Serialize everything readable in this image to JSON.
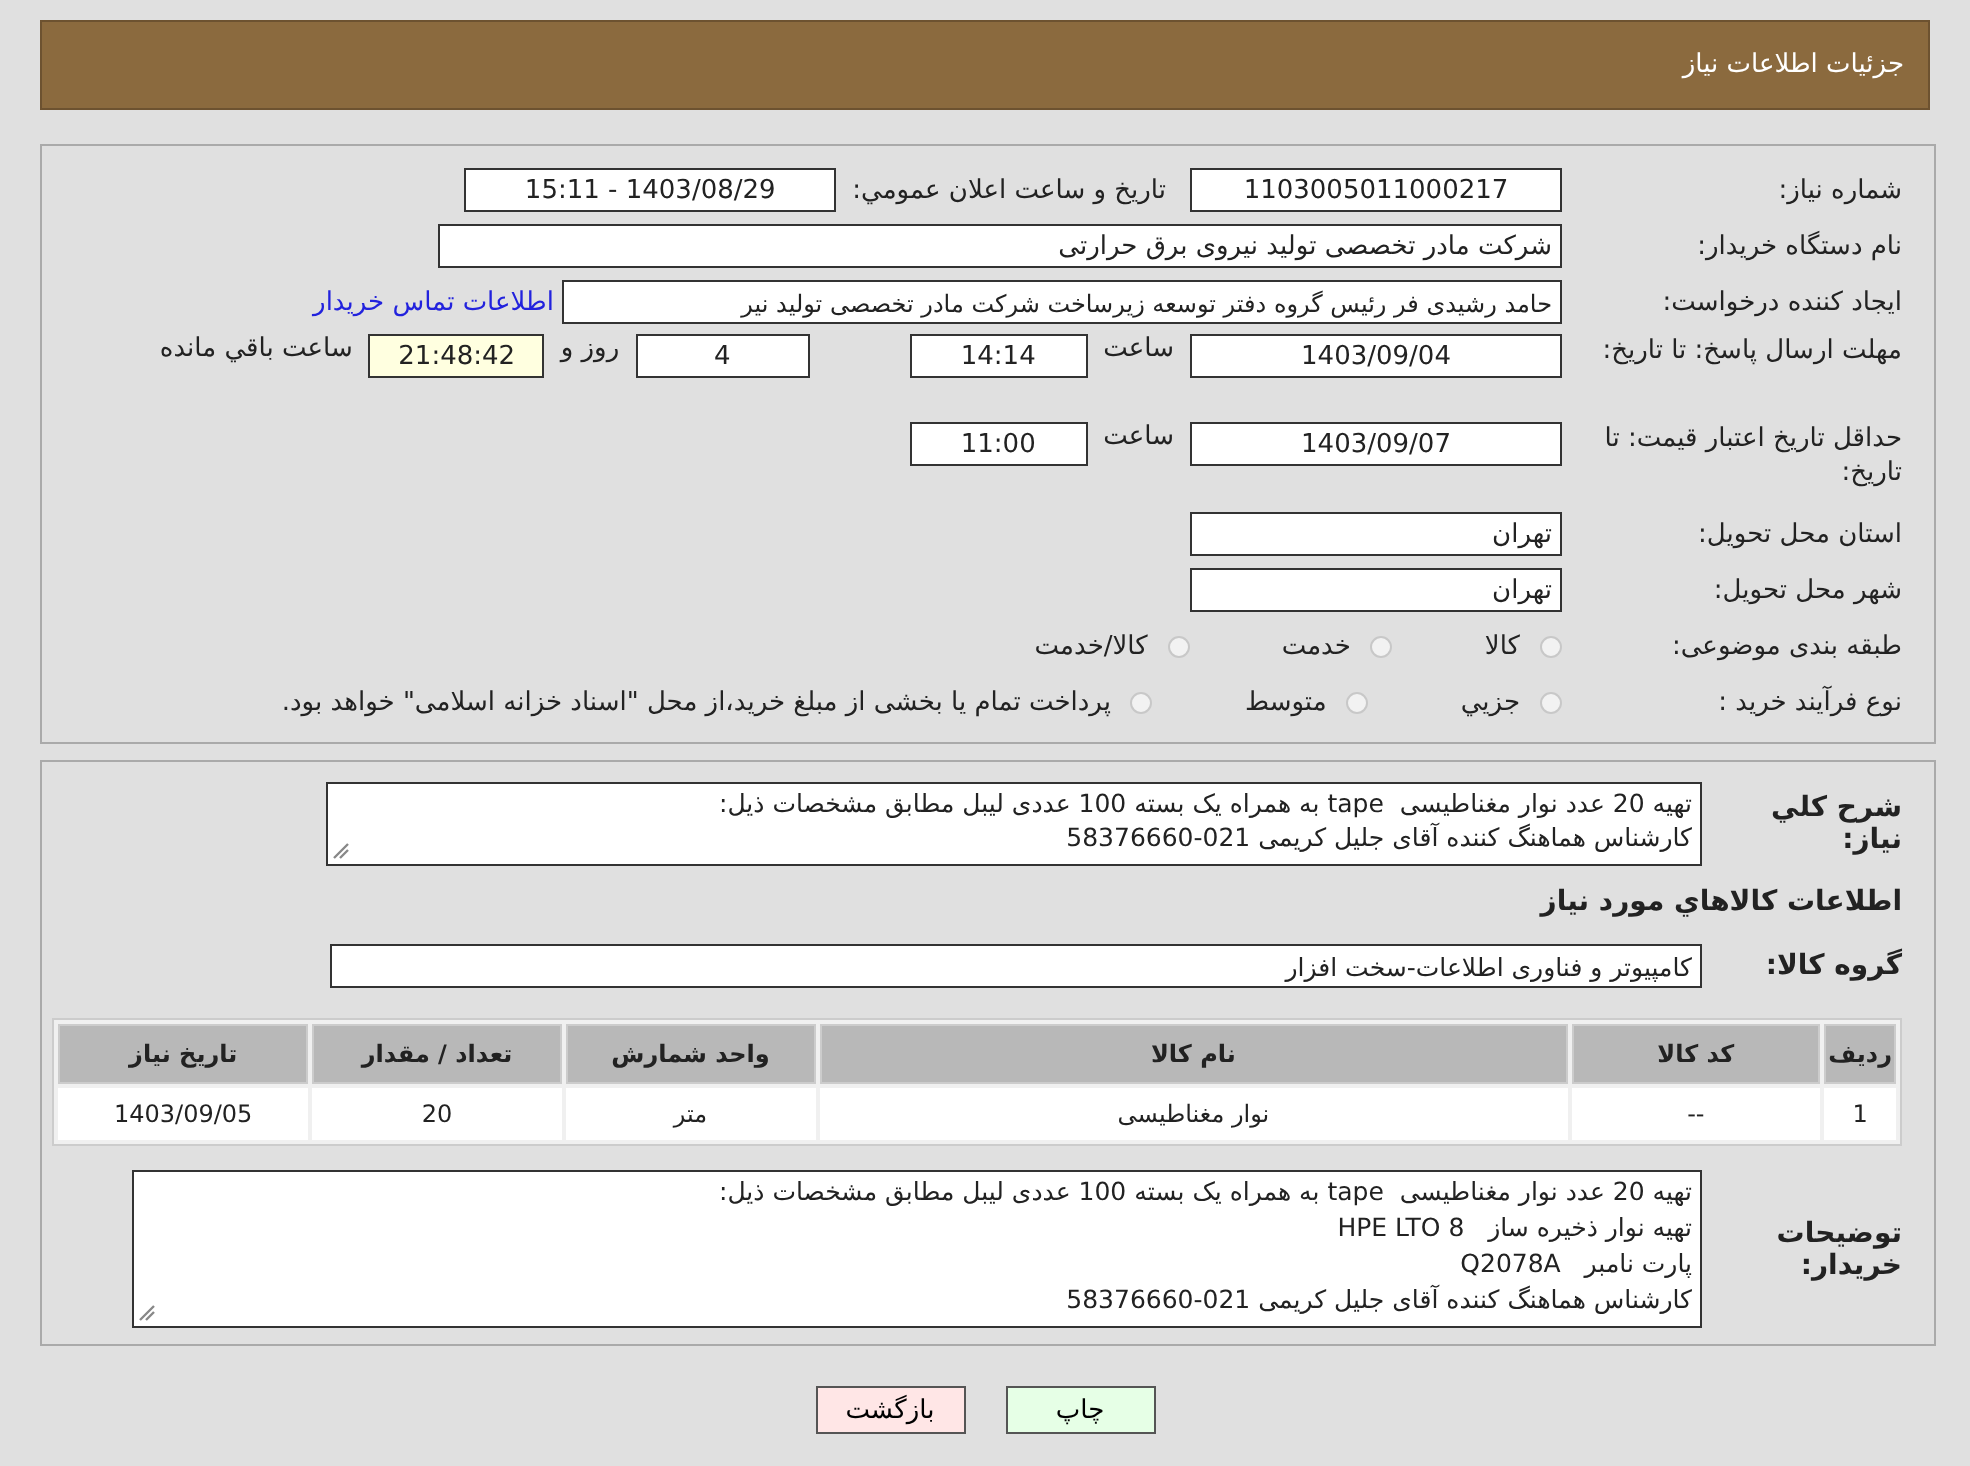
{
  "header": {
    "title": "جزئیات اطلاعات نیاز"
  },
  "form": {
    "need_number": {
      "label": "شماره نیاز:",
      "value": "1103005011000217"
    },
    "announce": {
      "label": "تاریخ و ساعت اعلان عمومي:",
      "value": "1403/08/29 - 15:11"
    },
    "buyer": {
      "label": "نام دستگاه خریدار:",
      "value": "شرکت مادر تخصصی تولید نیروی برق حرارتی"
    },
    "creator": {
      "label": "ایجاد کننده درخواست:",
      "value": "حامد رشیدی فر رئیس گروه دفتر توسعه زیرساخت شرکت مادر تخصصی تولید نیر",
      "link": "اطلاعات تماس خریدار"
    },
    "deadline": {
      "label": "مهلت ارسال پاسخ: تا تاریخ:",
      "date": "1403/09/04",
      "time_label": "ساعت",
      "time": "14:14",
      "days": "4",
      "days_label": "روز و",
      "remaining": "21:48:42",
      "remaining_label": "ساعت باقي مانده"
    },
    "validity": {
      "label": "حداقل تاریخ اعتبار قیمت: تا تاریخ:",
      "date": "1403/09/07",
      "time_label": "ساعت",
      "time": "11:00"
    },
    "province": {
      "label": "استان محل تحویل:",
      "value": "تهران"
    },
    "city": {
      "label": "شهر محل تحویل:",
      "value": "تهران"
    },
    "category": {
      "label": "طبقه بندی موضوعی:",
      "options": [
        {
          "label": "کالا",
          "selected": false
        },
        {
          "label": "خدمت",
          "selected": false
        },
        {
          "label": "کالا/خدمت",
          "selected": false
        }
      ]
    },
    "process": {
      "label": "نوع فرآیند خرید :",
      "options": [
        {
          "label": "جزيي",
          "selected": false
        },
        {
          "label": "متوسط",
          "selected": false
        },
        {
          "label": "پرداخت تمام یا بخشی از مبلغ خرید،از محل \"اسناد خزانه اسلامی\" خواهد بود.",
          "selected": false
        }
      ]
    }
  },
  "details": {
    "summary": {
      "label": "شرح کلي نیاز:",
      "lines": [
        "تهیه 20 عدد نوار مغناطیسی  tape به همراه یک بسته 100 عددی لیبل مطابق مشخصات ذیل:",
        "کارشناس هماهنگ کننده آقای جلیل کریمی 021-58376660"
      ]
    },
    "goods_heading": "اطلاعات کالاهاي مورد نیاز",
    "group": {
      "label": "گروه کالا:",
      "value": "کامپیوتر و فناوری اطلاعات-سخت افزار"
    },
    "table": {
      "columns": [
        "ردیف",
        "کد کالا",
        "نام کالا",
        "واحد شمارش",
        "تعداد / مقدار",
        "تاریخ نیاز"
      ],
      "rows": [
        [
          "1",
          "--",
          "نوار مغناطیسی",
          "متر",
          "20",
          "1403/09/05"
        ]
      ]
    },
    "notes": {
      "label": "توضیحات خریدار:",
      "lines": [
        "تهیه 20 عدد نوار مغناطیسی  tape به همراه یک بسته 100 عددی لیبل مطابق مشخصات ذیل:",
        "تهیه نوار ذخیره ساز   HPE LTO 8",
        "پارت نامبر   Q2078A",
        "کارشناس هماهنگ کننده آقای جلیل کریمی 021-58376660"
      ]
    }
  },
  "buttons": [
    {
      "label": "چاپ",
      "kind": "print"
    },
    {
      "label": "بازگشت",
      "kind": "back"
    }
  ]
}
